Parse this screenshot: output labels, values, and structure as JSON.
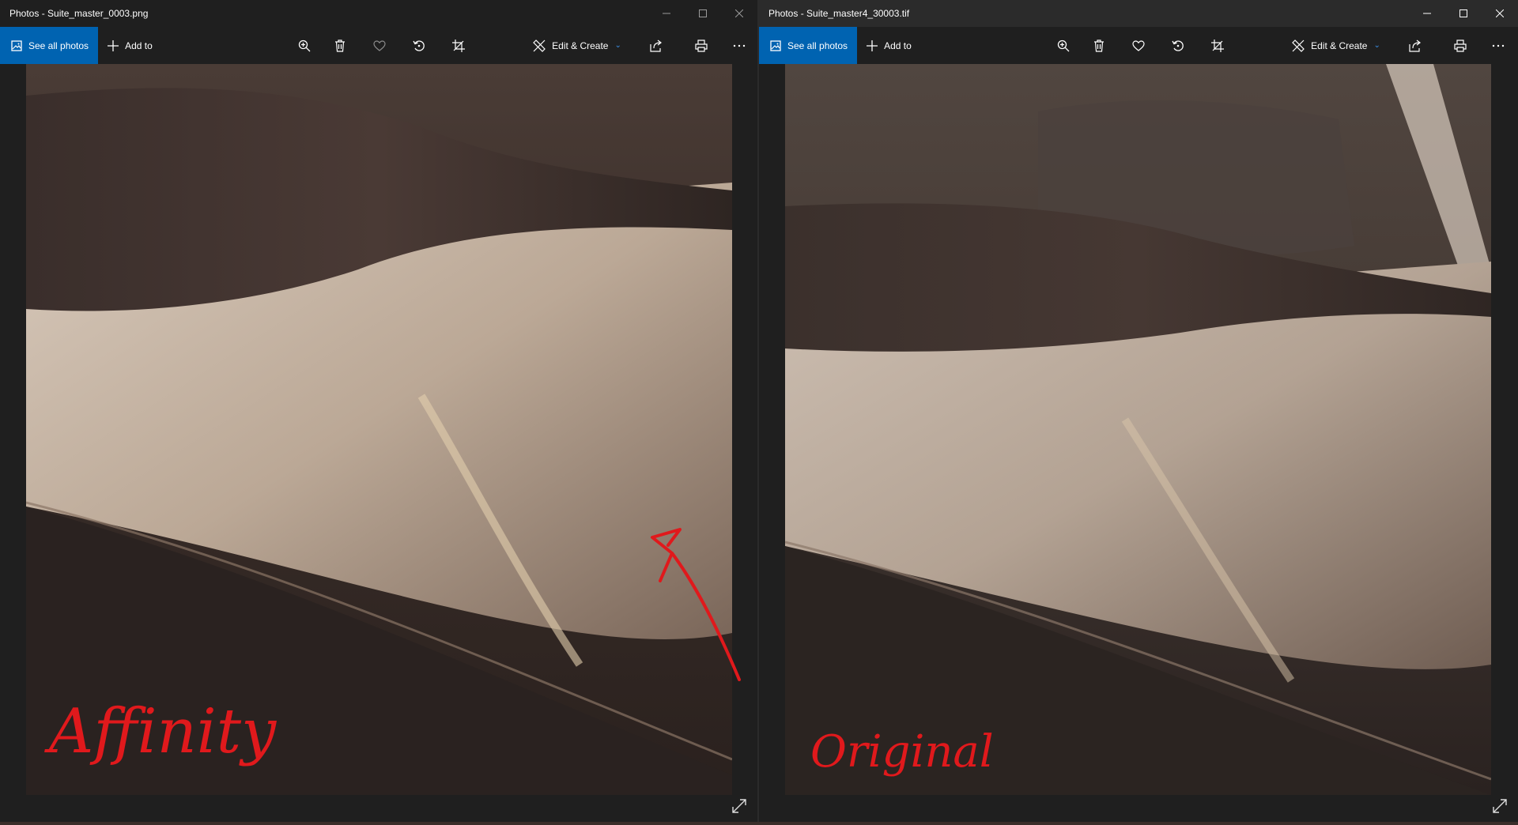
{
  "windows": [
    {
      "title": "Photos - Suite_master_0003.png",
      "toolbar": {
        "see_all_photos": "See all photos",
        "add_to": "Add to",
        "edit_create": "Edit & Create"
      },
      "annotation": "Affinity",
      "annotation_color": "#e0191c",
      "favorite_enabled": false
    },
    {
      "title": "Photos - Suite_master4_30003.tif",
      "toolbar": {
        "see_all_photos": "See all photos",
        "add_to": "Add to",
        "edit_create": "Edit & Create"
      },
      "annotation": "Original",
      "annotation_color": "#e0191c",
      "favorite_enabled": true
    }
  ],
  "colors": {
    "accent": "#0063b1",
    "chevron": "#3a8ee6",
    "background": "#1f1f1f"
  },
  "icons": {
    "toolbar": [
      "photos-icon",
      "plus-icon",
      "zoom-in-icon",
      "delete-icon",
      "heart-icon",
      "rotate-icon",
      "crop-icon",
      "edit-create-icon",
      "share-icon",
      "print-icon",
      "more-icon"
    ],
    "window": [
      "minimize-icon",
      "maximize-icon",
      "close-icon"
    ],
    "viewer": [
      "expand-icon"
    ]
  }
}
